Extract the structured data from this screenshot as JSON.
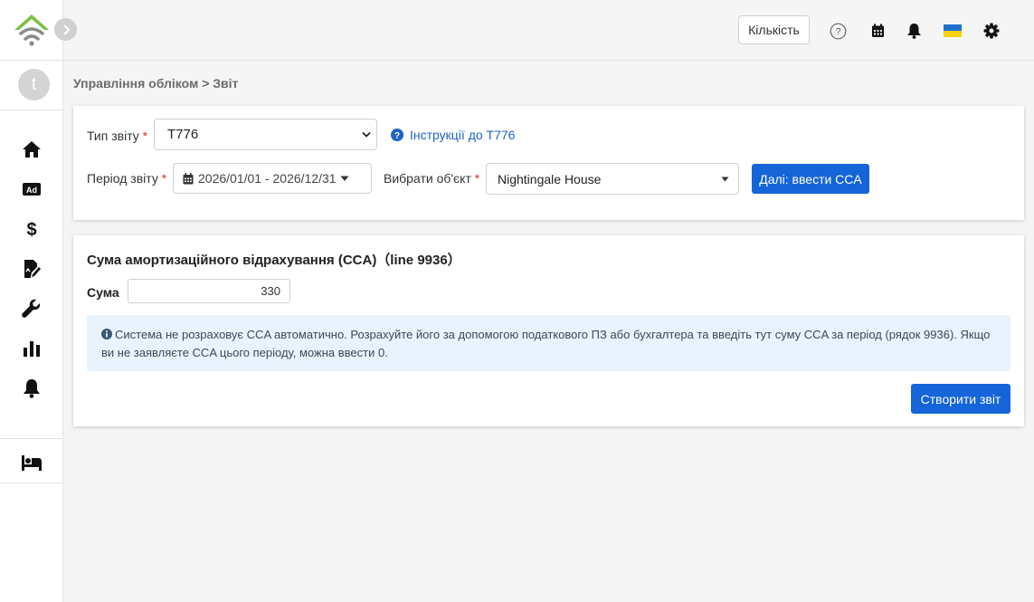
{
  "sidebar": {
    "avatar_letter": "t",
    "nav": [
      "home-icon",
      "ad-icon",
      "dollar-icon",
      "file-edit-icon",
      "wrench-icon",
      "bar-chart-icon",
      "bell-icon",
      "bed-icon"
    ]
  },
  "topbar": {
    "quantity_label": "Кількість",
    "icons": [
      "help-icon",
      "calendar-icon",
      "bell-icon",
      "ukraine-flag-icon",
      "gear-icon"
    ]
  },
  "breadcrumb": "Управління обліком > Звіт",
  "report_form": {
    "type_label": "Тип звіту",
    "type_value": "T776",
    "instructions_link": "Інструкції до T776",
    "period_label": "Період звіту",
    "period_value": "2026/01/01 - 2026/12/31",
    "object_label": "Вибрати об'єкт",
    "object_value": "Nightingale House",
    "next_button": "Далі: ввести CCA"
  },
  "cca": {
    "title": "Сума амортизаційного відрахування (CCA)（line 9936）",
    "amount_label": "Сума",
    "amount_value": "330",
    "info_text": "Система не розраховує CCA автоматично. Розрахуйте його за допомогою податкового ПЗ або бухгалтера та введіть тут суму CCA за період (рядок 9936). Якщо ви не заявляєте CCA цього періоду, можна ввести 0.",
    "create_button": "Створити звіт"
  },
  "colors": {
    "primary": "#1565d8",
    "logo_green": "#7cc143",
    "logo_gray": "#8a8a8a",
    "info_bg": "#e8f3fd",
    "required": "#d93025"
  }
}
